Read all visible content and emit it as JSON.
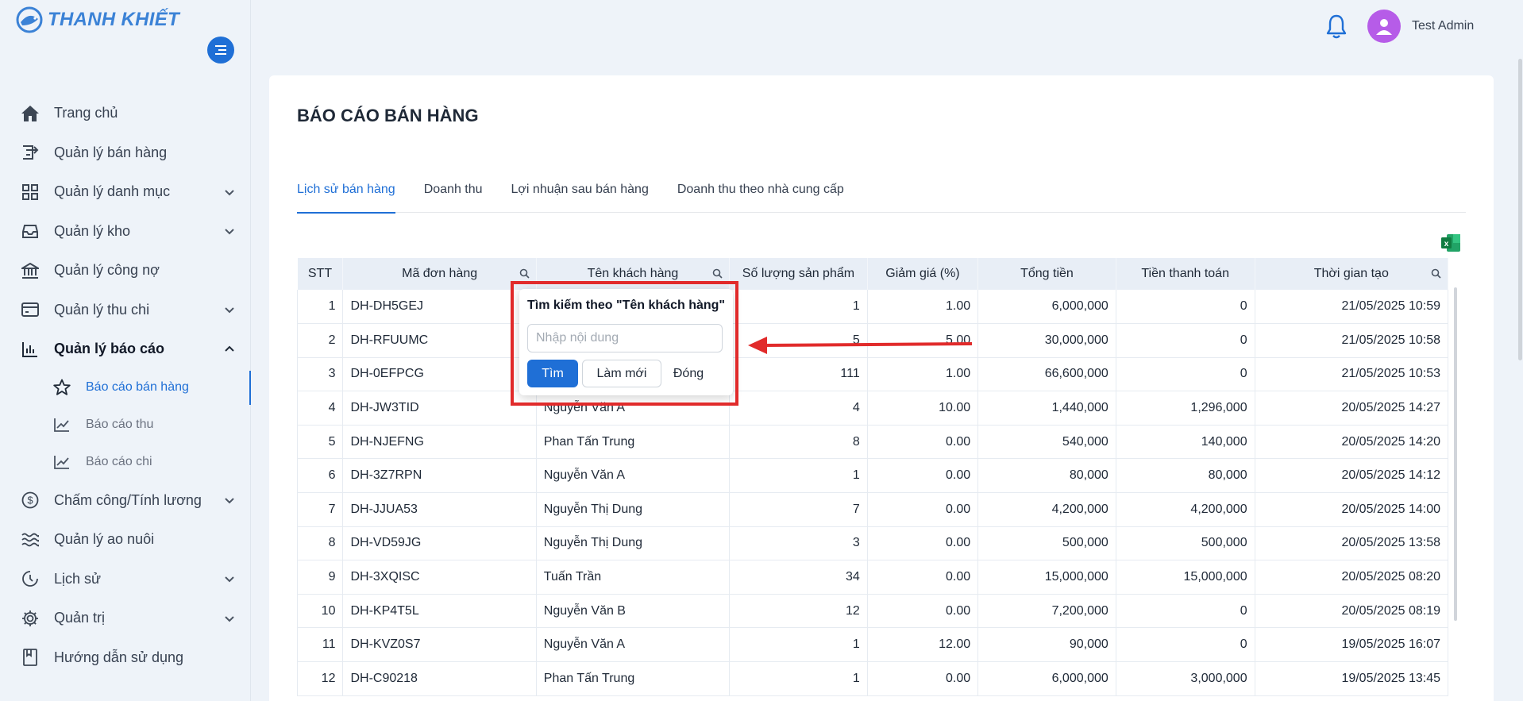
{
  "brand": {
    "name": "THANH KHIẾT"
  },
  "sidebar": {
    "items": [
      {
        "label": "Trang chủ",
        "icon": "home-icon"
      },
      {
        "label": "Quản lý bán hàng",
        "icon": "sales-icon"
      },
      {
        "label": "Quản lý danh mục",
        "icon": "grid-icon",
        "expandable": true
      },
      {
        "label": "Quản lý kho",
        "icon": "inbox-icon",
        "expandable": true
      },
      {
        "label": "Quản lý công nợ",
        "icon": "bank-icon"
      },
      {
        "label": "Quản lý thu chi",
        "icon": "wallet-icon",
        "expandable": true
      },
      {
        "label": "Quản lý báo cáo",
        "icon": "bar-chart-icon",
        "expandable": true,
        "expanded": true
      },
      {
        "label": "Chấm công/Tính lương",
        "icon": "dollar-icon",
        "expandable": true
      },
      {
        "label": "Quản lý ao nuôi",
        "icon": "waves-icon"
      },
      {
        "label": "Lịch sử",
        "icon": "history-icon",
        "expandable": true
      },
      {
        "label": "Quản trị",
        "icon": "gear-icon",
        "expandable": true
      },
      {
        "label": "Hướng dẫn sử dụng",
        "icon": "book-icon"
      }
    ],
    "sub_items": [
      {
        "label": "Báo cáo bán hàng",
        "icon": "star-icon",
        "active": true
      },
      {
        "label": "Báo cáo thu",
        "icon": "line-chart-icon"
      },
      {
        "label": "Báo cáo chi",
        "icon": "line-chart-icon"
      }
    ]
  },
  "header": {
    "user_name": "Test Admin"
  },
  "page": {
    "title": "BÁO CÁO BÁN HÀNG",
    "tabs": [
      "Lịch sử bán hàng",
      "Doanh thu",
      "Lợi nhuận sau bán hàng",
      "Doanh thu theo nhà cung cấp"
    ],
    "active_tab": 0
  },
  "table": {
    "columns": [
      "STT",
      "Mã đơn hàng",
      "Tên khách hàng",
      "Số lượng sản phẩm",
      "Giảm giá (%)",
      "Tổng tiền",
      "Tiền thanh toán",
      "Thời gian tạo"
    ],
    "rows": [
      [
        "1",
        "DH-DH5GEJ",
        "",
        "1",
        "1.00",
        "6,000,000",
        "0",
        "21/05/2025 10:59"
      ],
      [
        "2",
        "DH-RFUUMC",
        "",
        "5",
        "5.00",
        "30,000,000",
        "0",
        "21/05/2025 10:58"
      ],
      [
        "3",
        "DH-0EFPCG",
        "",
        "111",
        "1.00",
        "66,600,000",
        "0",
        "21/05/2025 10:53"
      ],
      [
        "4",
        "DH-JW3TID",
        "Nguyễn Văn A",
        "4",
        "10.00",
        "1,440,000",
        "1,296,000",
        "20/05/2025 14:27"
      ],
      [
        "5",
        "DH-NJEFNG",
        "Phan Tấn Trung",
        "8",
        "0.00",
        "540,000",
        "140,000",
        "20/05/2025 14:20"
      ],
      [
        "6",
        "DH-3Z7RPN",
        "Nguyễn Văn A",
        "1",
        "0.00",
        "80,000",
        "80,000",
        "20/05/2025 14:12"
      ],
      [
        "7",
        "DH-JJUA53",
        "Nguyễn Thị Dung",
        "7",
        "0.00",
        "4,200,000",
        "4,200,000",
        "20/05/2025 14:00"
      ],
      [
        "8",
        "DH-VD59JG",
        "Nguyễn Thị Dung",
        "3",
        "0.00",
        "500,000",
        "500,000",
        "20/05/2025 13:58"
      ],
      [
        "9",
        "DH-3XQISC",
        "Tuấn Trần",
        "34",
        "0.00",
        "15,000,000",
        "15,000,000",
        "20/05/2025 08:20"
      ],
      [
        "10",
        "DH-KP4T5L",
        "Nguyễn Văn B",
        "12",
        "0.00",
        "7,200,000",
        "0",
        "20/05/2025 08:19"
      ],
      [
        "11",
        "DH-KVZ0S7",
        "Nguyễn Văn A",
        "1",
        "12.00",
        "90,000",
        "0",
        "19/05/2025 16:07"
      ],
      [
        "12",
        "DH-C90218",
        "Phan Tấn Trung",
        "1",
        "0.00",
        "6,000,000",
        "3,000,000",
        "19/05/2025 13:45"
      ]
    ]
  },
  "search_popup": {
    "title": "Tìm kiếm theo \"Tên khách hàng\"",
    "input_value": "",
    "placeholder": "Nhập nội dung",
    "search_label": "Tìm",
    "reset_label": "Làm mới",
    "close_label": "Đóng"
  },
  "colors": {
    "primary": "#1f6fd6",
    "annotation": "#e12b2b",
    "avatar": "#b65ce8"
  }
}
